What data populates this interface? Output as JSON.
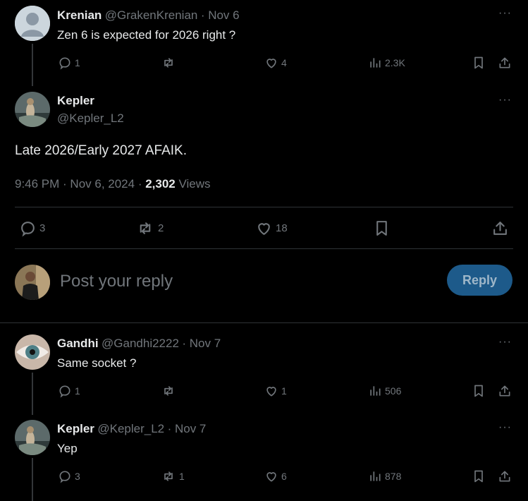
{
  "tweets": [
    {
      "name": "Krenian",
      "handle": "@GrakenKrenian",
      "date": "· Nov 6",
      "text": "Zen 6 is expected for 2026 right ?",
      "stats": {
        "replies": "1",
        "reposts": "",
        "likes": "4",
        "views": "2.3K"
      }
    },
    {
      "name": "Gandhi",
      "handle": "@Gandhi2222",
      "date": "· Nov 7",
      "text": "Same socket ?",
      "stats": {
        "replies": "1",
        "reposts": "",
        "likes": "1",
        "views": "506"
      }
    },
    {
      "name": "Kepler",
      "handle": "@Kepler_L2",
      "date": "· Nov 7",
      "text": "Yep",
      "stats": {
        "replies": "3",
        "reposts": "1",
        "likes": "6",
        "views": "878"
      }
    }
  ],
  "main_tweet": {
    "name": "Kepler",
    "handle": "@Kepler_L2",
    "text": "Late 2026/Early 2027 AFAIK.",
    "time": "9:46 PM · Nov 6, 2024 · ",
    "views_count": "2,302",
    "views_label": " Views",
    "stats": {
      "replies": "3",
      "reposts": "2",
      "likes": "18"
    }
  },
  "reply_box": {
    "placeholder": "Post your reply",
    "button_label": "Reply"
  },
  "more_label": "···",
  "colors": {
    "accent": "#1d9bf0",
    "muted": "#71767b",
    "reply_button": "#1d5a8a"
  }
}
